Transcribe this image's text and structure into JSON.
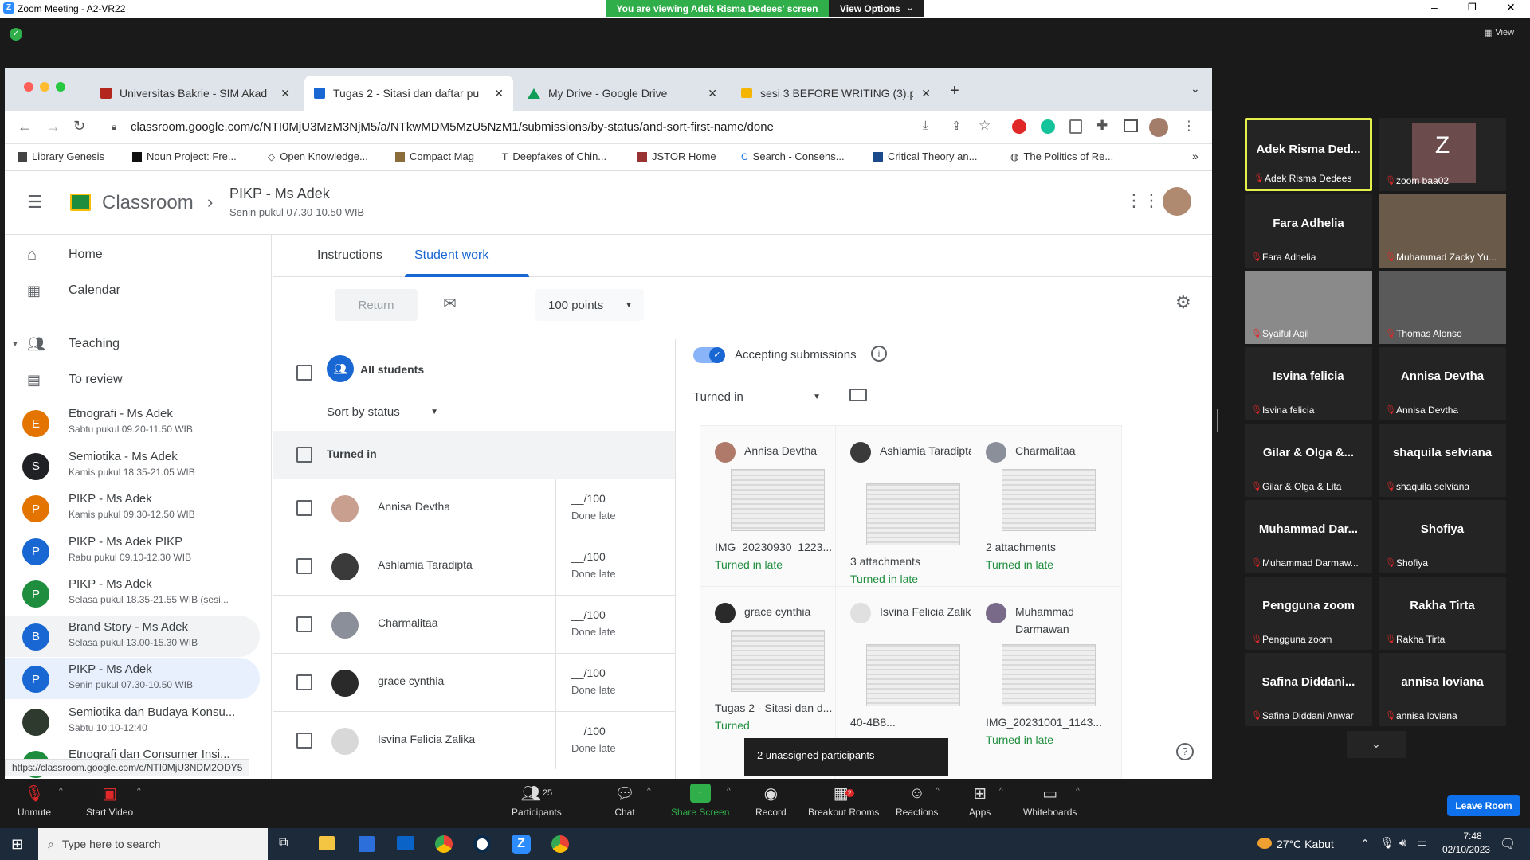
{
  "zoom": {
    "window_title": "Zoom Meeting - A2-VR22",
    "viewing_banner": "You are viewing Adek Risma Dedees' screen",
    "view_options": "View Options",
    "view_label": "View",
    "tooltip": "2 unassigned participants",
    "leave_room": "Leave Room"
  },
  "browser": {
    "tabs": [
      {
        "label": "Universitas Bakrie - SIM Akad"
      },
      {
        "label": "Tugas 2 - Sitasi dan daftar pu"
      },
      {
        "label": "My Drive - Google Drive"
      },
      {
        "label": "sesi 3 BEFORE WRITING (3).p"
      }
    ],
    "url": "classroom.google.com/c/NTI0MjU3MzM3NjM5/a/NTkwMDM5MzU5NzM1/submissions/by-status/and-sort-first-name/done",
    "status_url": "https://classroom.google.com/c/NTI0MjU3NDM2ODY5",
    "bookmarks": [
      "Library Genesis",
      "Noun Project: Fre...",
      "Open Knowledge...",
      "Compact Mag",
      "Deepfakes of Chin...",
      "JSTOR Home",
      "Search - Consens...",
      "Critical Theory an...",
      "The Politics of Re..."
    ]
  },
  "classroom": {
    "app_name": "Classroom",
    "class_title": "PIKP - Ms Adek",
    "class_subtitle": "Senin pukul 07.30-10.50 WIB",
    "nav": {
      "home": "Home",
      "calendar": "Calendar",
      "teaching": "Teaching",
      "to_review": "To review"
    },
    "classes": [
      {
        "letter": "E",
        "color": "#e37400",
        "name": "Etnografi - Ms Adek",
        "time": "Sabtu pukul 09.20-11.50 WIB"
      },
      {
        "letter": "S",
        "color": "#202124",
        "name": "Semiotika - Ms Adek",
        "time": "Kamis pukul 18.35-21.05 WIB"
      },
      {
        "letter": "P",
        "color": "#e37400",
        "name": "PIKP - Ms Adek",
        "time": "Kamis pukul 09.30-12.50 WIB"
      },
      {
        "letter": "P",
        "color": "#1967d2",
        "name": "PIKP - Ms Adek PIKP",
        "time": "Rabu pukul 09.10-12.30 WIB"
      },
      {
        "letter": "P",
        "color": "#1e8e3e",
        "name": "PIKP - Ms Adek",
        "time": "Selasa pukul 18.35-21.55 WIB (sesi..."
      },
      {
        "letter": "B",
        "color": "#1967d2",
        "name": "Brand Story - Ms Adek",
        "time": "Selasa pukul 13.00-15.30 WIB"
      },
      {
        "letter": "P",
        "color": "#1967d2",
        "name": "PIKP - Ms Adek",
        "time": "Senin pukul 07.30-10.50 WIB"
      },
      {
        "letter": "",
        "color": "#2d3a2d",
        "name": "Semiotika dan Budaya Konsu...",
        "time": "Sabtu 10:10-12:40"
      },
      {
        "letter": "E",
        "color": "#1e8e3e",
        "name": "Etnografi dan Consumer Insi...",
        "time": ""
      }
    ],
    "tabs": {
      "instructions": "Instructions",
      "student_work": "Student work"
    },
    "toolbar": {
      "return": "Return",
      "points": "100 points"
    },
    "all_students": "All students",
    "sort_by": "Sort by status",
    "section_turned_in": "Turned in",
    "accepting": "Accepting submissions",
    "filter_turned_in": "Turned in",
    "students": [
      {
        "name": "Annisa Devtha",
        "points": "__/100",
        "status": "Done late"
      },
      {
        "name": "Ashlamia Taradipta",
        "points": "__/100",
        "status": "Done late"
      },
      {
        "name": "Charmalitaa",
        "points": "__/100",
        "status": "Done late"
      },
      {
        "name": "grace cynthia",
        "points": "__/100",
        "status": "Done late"
      },
      {
        "name": "Isvina Felicia Zalika",
        "points": "__/100",
        "status": "Done late"
      }
    ],
    "cards": [
      {
        "name": "Annisa Devtha",
        "file": "IMG_20230930_1223...",
        "status": "Turned in late"
      },
      {
        "name": "Ashlamia Taradipta",
        "file": "3 attachments",
        "status": "Turned in late"
      },
      {
        "name": "Charmalitaa",
        "file": "2 attachments",
        "status": "Turned in late"
      },
      {
        "name": "grace cynthia",
        "file": "Tugas 2 - Sitasi dan d...",
        "status": "Turned"
      },
      {
        "name": "Isvina Felicia Zalika",
        "file": "40-4B8...",
        "status": ""
      },
      {
        "name": "Muhammad Darmawan",
        "file": "IMG_20231001_1143...",
        "status": "Turned in late"
      }
    ]
  },
  "participants": [
    {
      "big": "Adek Risma Ded...",
      "small": "Adek Risma Dedees",
      "video": false
    },
    {
      "big": "Z",
      "small": "zoom baa02",
      "video": false
    },
    {
      "big": "Fara Adhelia",
      "small": "Fara Adhelia",
      "video": false
    },
    {
      "big": "",
      "small": "Muhammad Zacky Yu...",
      "video": true
    },
    {
      "big": "",
      "small": "Syaiful Aqil",
      "video": true
    },
    {
      "big": "",
      "small": "Thomas Alonso",
      "video": true
    },
    {
      "big": "Isvina felicia",
      "small": "Isvina felicia",
      "video": false
    },
    {
      "big": "Annisa Devtha",
      "small": "Annisa Devtha",
      "video": false
    },
    {
      "big": "Gilar & Olga &...",
      "small": "Gilar & Olga & Lita",
      "video": false
    },
    {
      "big": "shaquila selviana",
      "small": "shaquila selviana",
      "video": false
    },
    {
      "big": "Muhammad Dar...",
      "small": "Muhammad Darmaw...",
      "video": false
    },
    {
      "big": "Shofiya",
      "small": "Shofiya",
      "video": false
    },
    {
      "big": "Pengguna zoom",
      "small": "Pengguna zoom",
      "video": false
    },
    {
      "big": "Rakha Tirta",
      "small": "Rakha Tirta",
      "video": false
    },
    {
      "big": "Safina Diddani...",
      "small": "Safina Diddani Anwar",
      "video": false
    },
    {
      "big": "annisa loviana",
      "small": "annisa loviana",
      "video": false
    }
  ],
  "controls": {
    "unmute": "Unmute",
    "start_video": "Start Video",
    "participants": "Participants",
    "participants_count": "25",
    "chat": "Chat",
    "share": "Share Screen",
    "record": "Record",
    "breakout": "Breakout Rooms",
    "breakout_badge": "2",
    "reactions": "Reactions",
    "apps": "Apps",
    "whiteboards": "Whiteboards"
  },
  "taskbar": {
    "search": "Type here to search",
    "weather": "27°C Kabut",
    "time": "7:48",
    "date": "02/10/2023"
  }
}
